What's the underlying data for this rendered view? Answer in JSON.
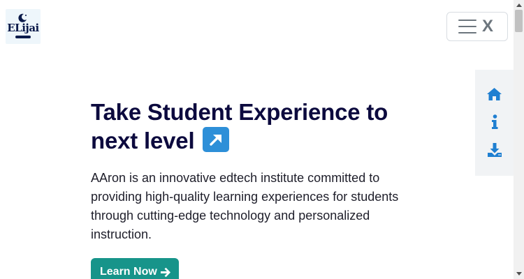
{
  "brand": {
    "logo_text": "ELijai"
  },
  "navbar": {
    "close_label": "X"
  },
  "side_menu": {
    "items": [
      {
        "icon": "home-icon"
      },
      {
        "icon": "info-icon"
      },
      {
        "icon": "download-icon"
      }
    ]
  },
  "hero": {
    "title": "Take Student Experience to next level",
    "arrow_icon": "north-east-arrow-icon",
    "description": "AAron is an innovative edtech institute committed to providing high-quality learning experiences for students through cutting-edge technology and personalized instruction.",
    "cta_label": "Learn Now"
  },
  "colors": {
    "heading": "#0c0a3e",
    "accent": "#17948a",
    "side_icon": "#1f7fd1",
    "arrow_badge": "#2d8fd8"
  }
}
